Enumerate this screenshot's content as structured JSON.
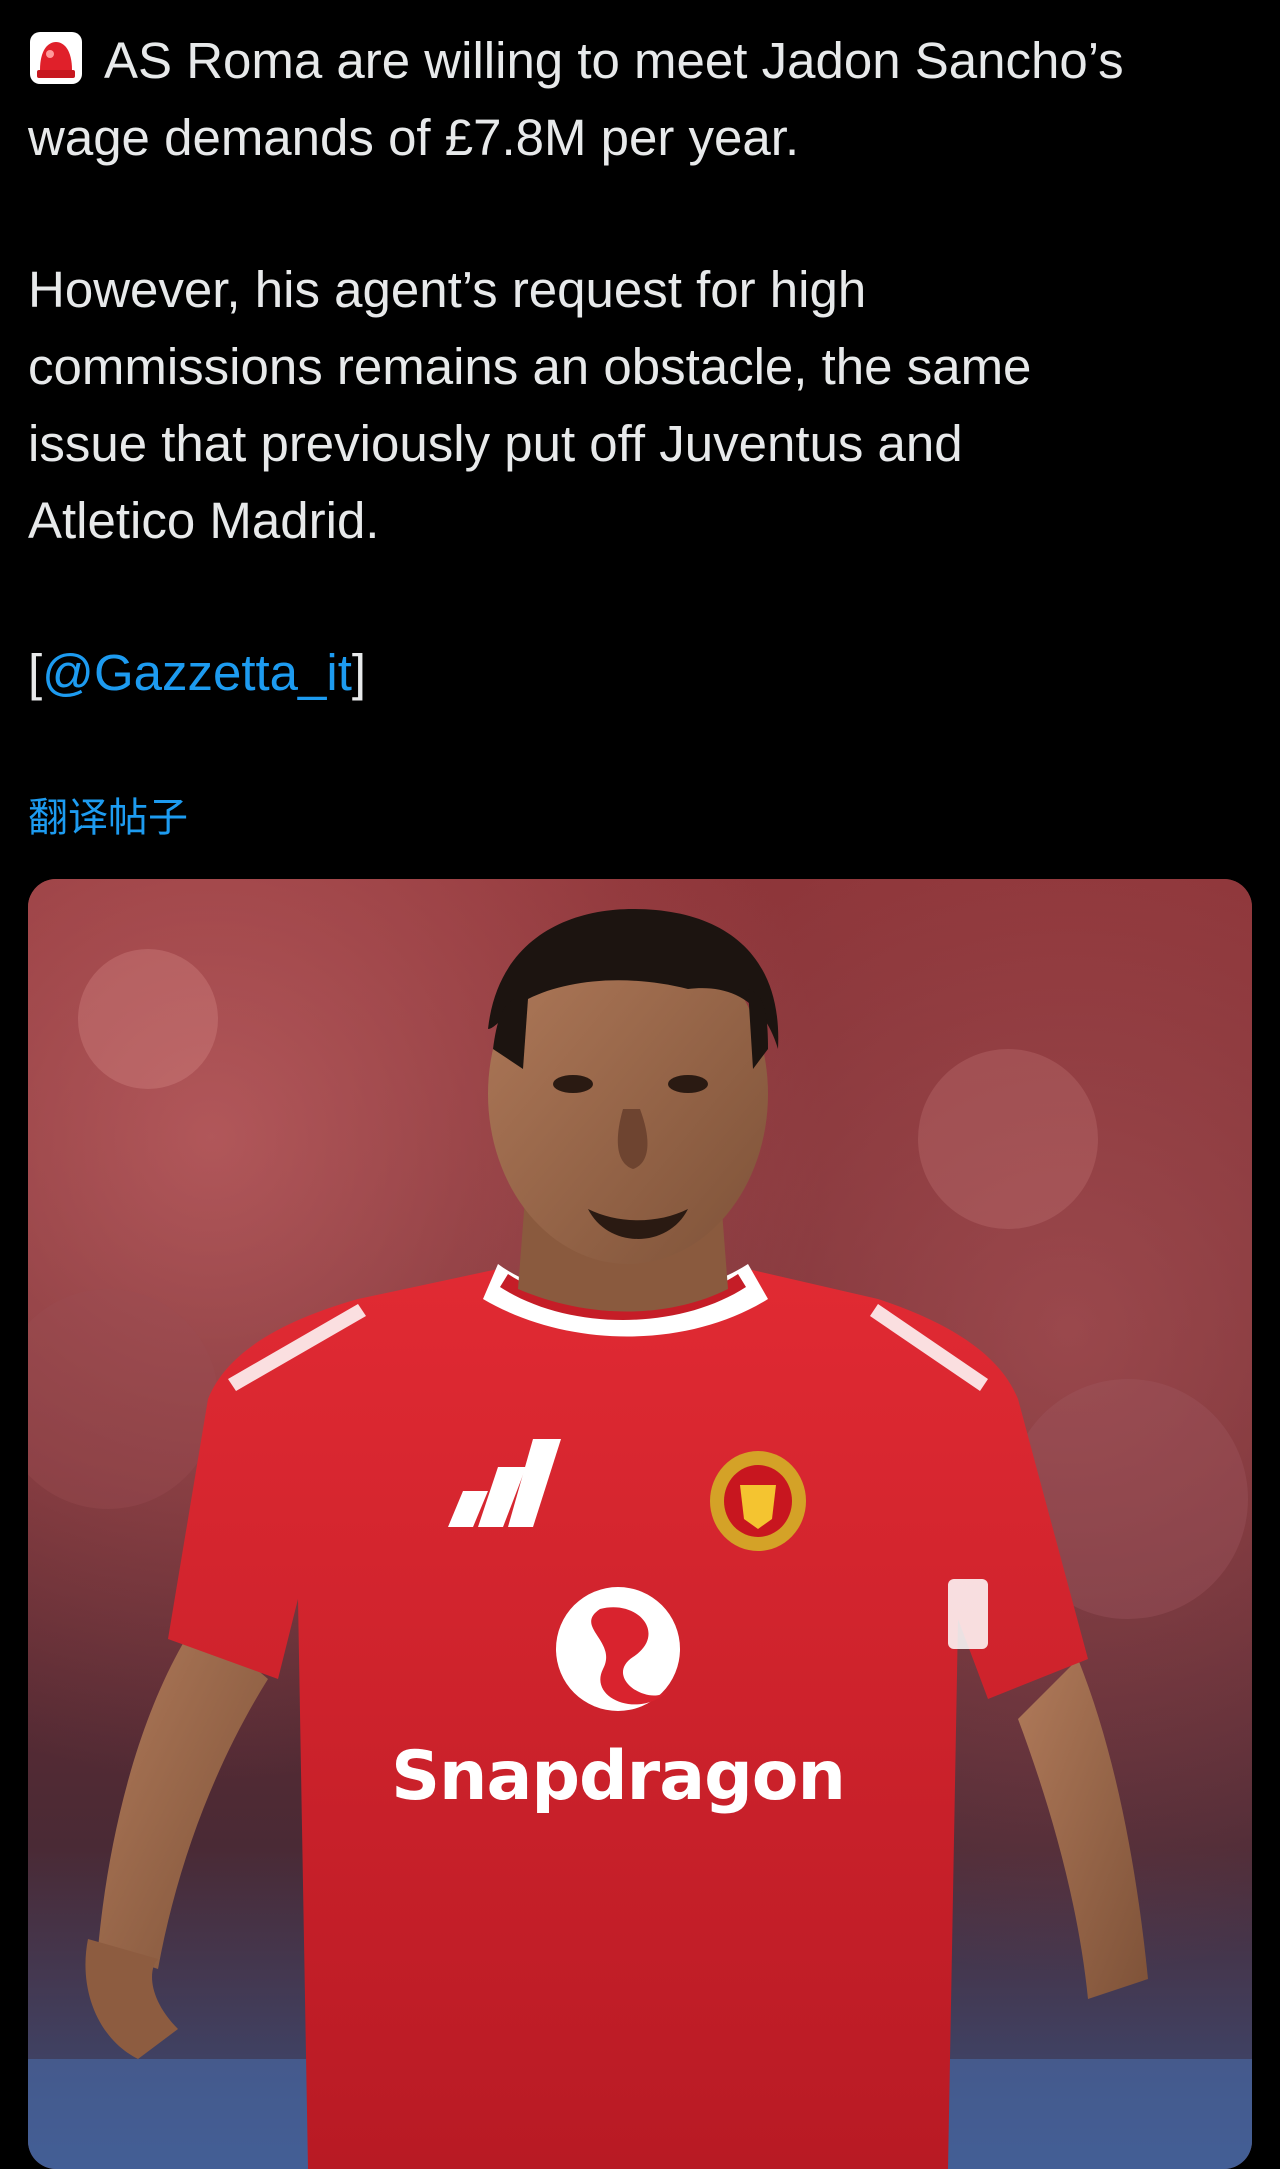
{
  "tweet": {
    "lines_para1": [
      "AS Roma are willing to meet Jadon Sancho’s",
      "wage demands of £7.8M per year."
    ],
    "lines_para2": [
      "However, his agent’s request for high",
      "commissions remains an obstacle, the same",
      "issue that previously put off Juventus and",
      "Atletico Madrid."
    ],
    "source": {
      "open": "[",
      "mention": "@Gazzetta_it",
      "close": "]"
    },
    "lead_icon": "rotating-light-siren-icon",
    "translate_label": "翻译帖子"
  },
  "media": {
    "sponsor": "Snapdragon",
    "jersey_color": "#d9232e",
    "background_color": "#6f2a2e"
  },
  "colors": {
    "background": "#000000",
    "text": "#e7e9ea",
    "link": "#1d9bf0"
  }
}
